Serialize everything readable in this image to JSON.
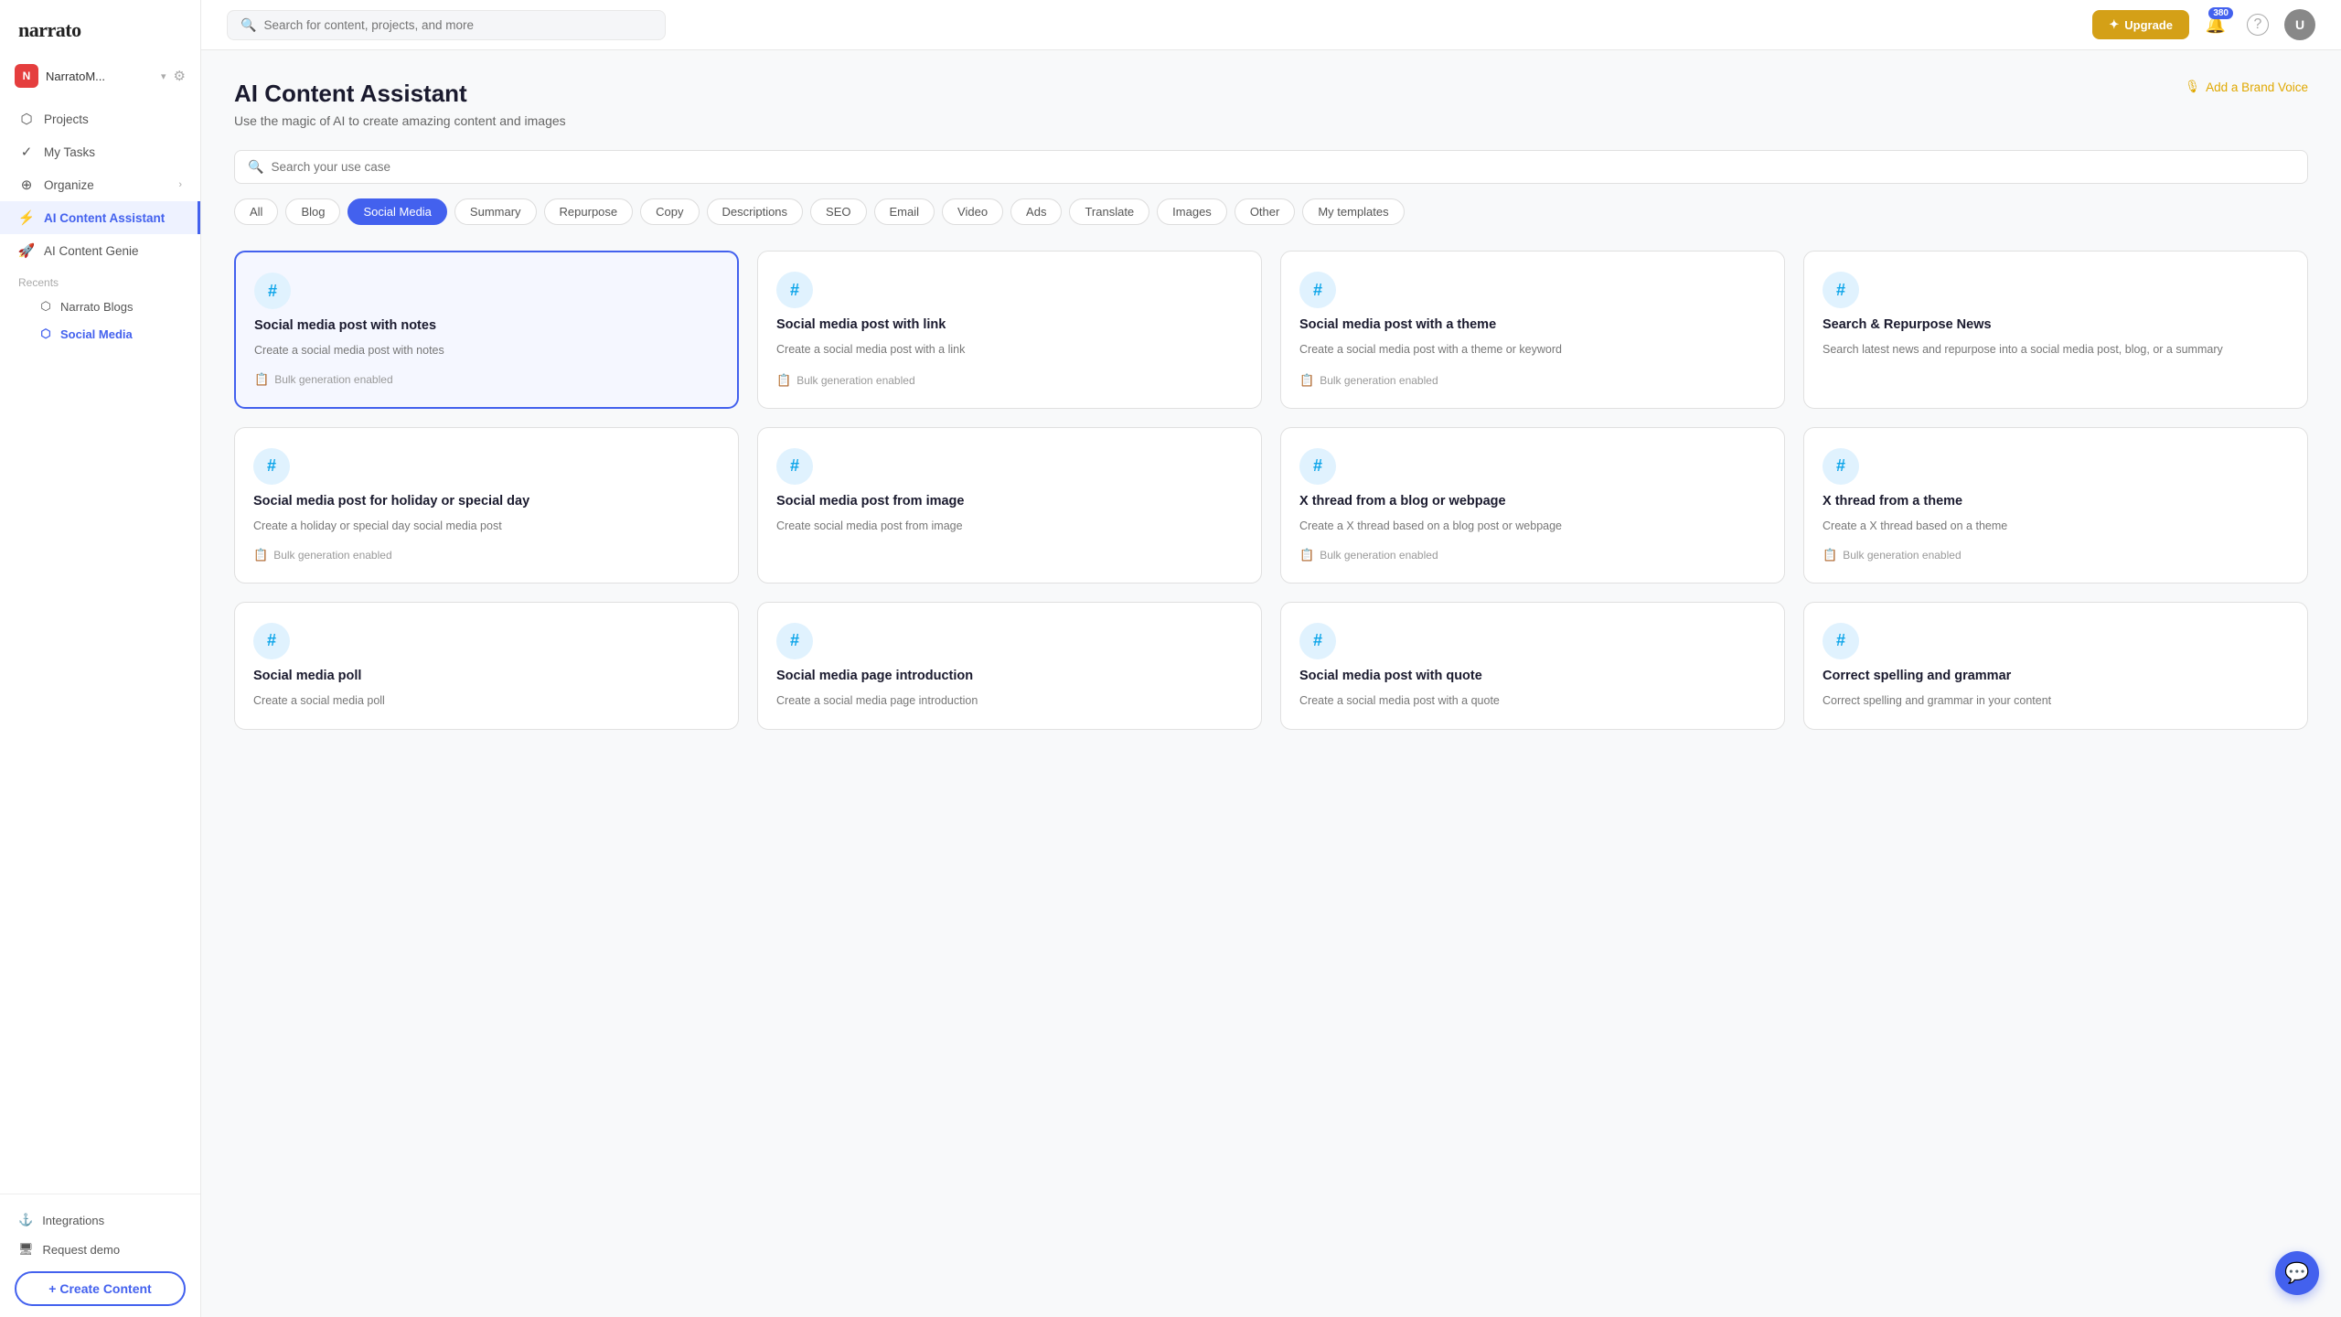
{
  "sidebar": {
    "logo": "narrato",
    "workspace": {
      "initial": "N",
      "name": "NarratoM...",
      "color": "#e53e3e"
    },
    "nav_items": [
      {
        "id": "projects",
        "label": "Projects",
        "icon": "⬡"
      },
      {
        "id": "my-tasks",
        "label": "My Tasks",
        "icon": "✓"
      },
      {
        "id": "organize",
        "label": "Organize",
        "icon": "⊕",
        "has_arrow": true
      },
      {
        "id": "ai-content-assistant",
        "label": "AI Content Assistant",
        "icon": "⚡",
        "active": true
      },
      {
        "id": "ai-content-genie",
        "label": "AI Content Genie",
        "icon": "🚀"
      }
    ],
    "recents_label": "Recents",
    "recents": [
      {
        "id": "narrato-blogs",
        "label": "Narrato Blogs",
        "active": false
      },
      {
        "id": "social-media",
        "label": "Social Media",
        "active": true
      }
    ],
    "bottom_items": [
      {
        "id": "integrations",
        "label": "Integrations",
        "icon": "⚓"
      },
      {
        "id": "request-demo",
        "label": "Request demo",
        "icon": "🖥"
      }
    ],
    "create_button_label": "+ Create Content"
  },
  "topbar": {
    "search_placeholder": "Search for content, projects, and more",
    "upgrade_label": "Upgrade",
    "notification_count": "380",
    "help_icon": "?"
  },
  "page": {
    "title": "AI Content Assistant",
    "subtitle": "Use the magic of AI to create amazing content and images",
    "brand_voice_label": "Add a Brand Voice"
  },
  "search": {
    "placeholder": "Search your use case"
  },
  "filters": [
    {
      "id": "all",
      "label": "All",
      "active": false
    },
    {
      "id": "blog",
      "label": "Blog",
      "active": false
    },
    {
      "id": "social-media",
      "label": "Social Media",
      "active": true
    },
    {
      "id": "summary",
      "label": "Summary",
      "active": false
    },
    {
      "id": "repurpose",
      "label": "Repurpose",
      "active": false
    },
    {
      "id": "copy",
      "label": "Copy",
      "active": false
    },
    {
      "id": "descriptions",
      "label": "Descriptions",
      "active": false
    },
    {
      "id": "seo",
      "label": "SEO",
      "active": false
    },
    {
      "id": "email",
      "label": "Email",
      "active": false
    },
    {
      "id": "video",
      "label": "Video",
      "active": false
    },
    {
      "id": "ads",
      "label": "Ads",
      "active": false
    },
    {
      "id": "translate",
      "label": "Translate",
      "active": false
    },
    {
      "id": "images",
      "label": "Images",
      "active": false
    },
    {
      "id": "other",
      "label": "Other",
      "active": false
    },
    {
      "id": "my-templates",
      "label": "My templates",
      "active": false
    }
  ],
  "cards": [
    {
      "id": "social-notes",
      "title": "Social media post with notes",
      "desc": "Create a social media post with notes",
      "bulk": true,
      "selected": true,
      "icon": "#"
    },
    {
      "id": "social-link",
      "title": "Social media post with link",
      "desc": "Create a social media post with a link",
      "bulk": true,
      "selected": false,
      "icon": "#"
    },
    {
      "id": "social-theme",
      "title": "Social media post with a theme",
      "desc": "Create a social media post with a theme or keyword",
      "bulk": true,
      "selected": false,
      "icon": "#"
    },
    {
      "id": "search-repurpose",
      "title": "Search & Repurpose News",
      "desc": "Search latest news and repurpose into a social media post, blog, or a summary",
      "bulk": false,
      "selected": false,
      "icon": "#"
    },
    {
      "id": "social-holiday",
      "title": "Social media post for holiday or special day",
      "desc": "Create a holiday or special day social media post",
      "bulk": true,
      "selected": false,
      "icon": "#"
    },
    {
      "id": "social-image",
      "title": "Social media post from image",
      "desc": "Create social media post from image",
      "bulk": false,
      "selected": false,
      "icon": "#"
    },
    {
      "id": "x-thread-blog",
      "title": "X thread from a blog or webpage",
      "desc": "Create a X thread based on a blog post or webpage",
      "bulk": true,
      "selected": false,
      "icon": "#"
    },
    {
      "id": "x-thread-theme",
      "title": "X thread from a theme",
      "desc": "Create a X thread based on a theme",
      "bulk": true,
      "selected": false,
      "icon": "#"
    },
    {
      "id": "social-poll",
      "title": "Social media poll",
      "desc": "Create a social media poll",
      "bulk": false,
      "selected": false,
      "icon": "#"
    },
    {
      "id": "social-page-intro",
      "title": "Social media page introduction",
      "desc": "Create a social media page introduction",
      "bulk": false,
      "selected": false,
      "icon": "#"
    },
    {
      "id": "social-quote",
      "title": "Social media post with quote",
      "desc": "Create a social media post with a quote",
      "bulk": false,
      "selected": false,
      "icon": "#"
    },
    {
      "id": "spelling-grammar",
      "title": "Correct spelling and grammar",
      "desc": "Correct spelling and grammar in your content",
      "bulk": false,
      "selected": false,
      "icon": "#"
    }
  ],
  "labels": {
    "bulk_enabled": "Bulk generation enabled",
    "recents": "Recents"
  }
}
